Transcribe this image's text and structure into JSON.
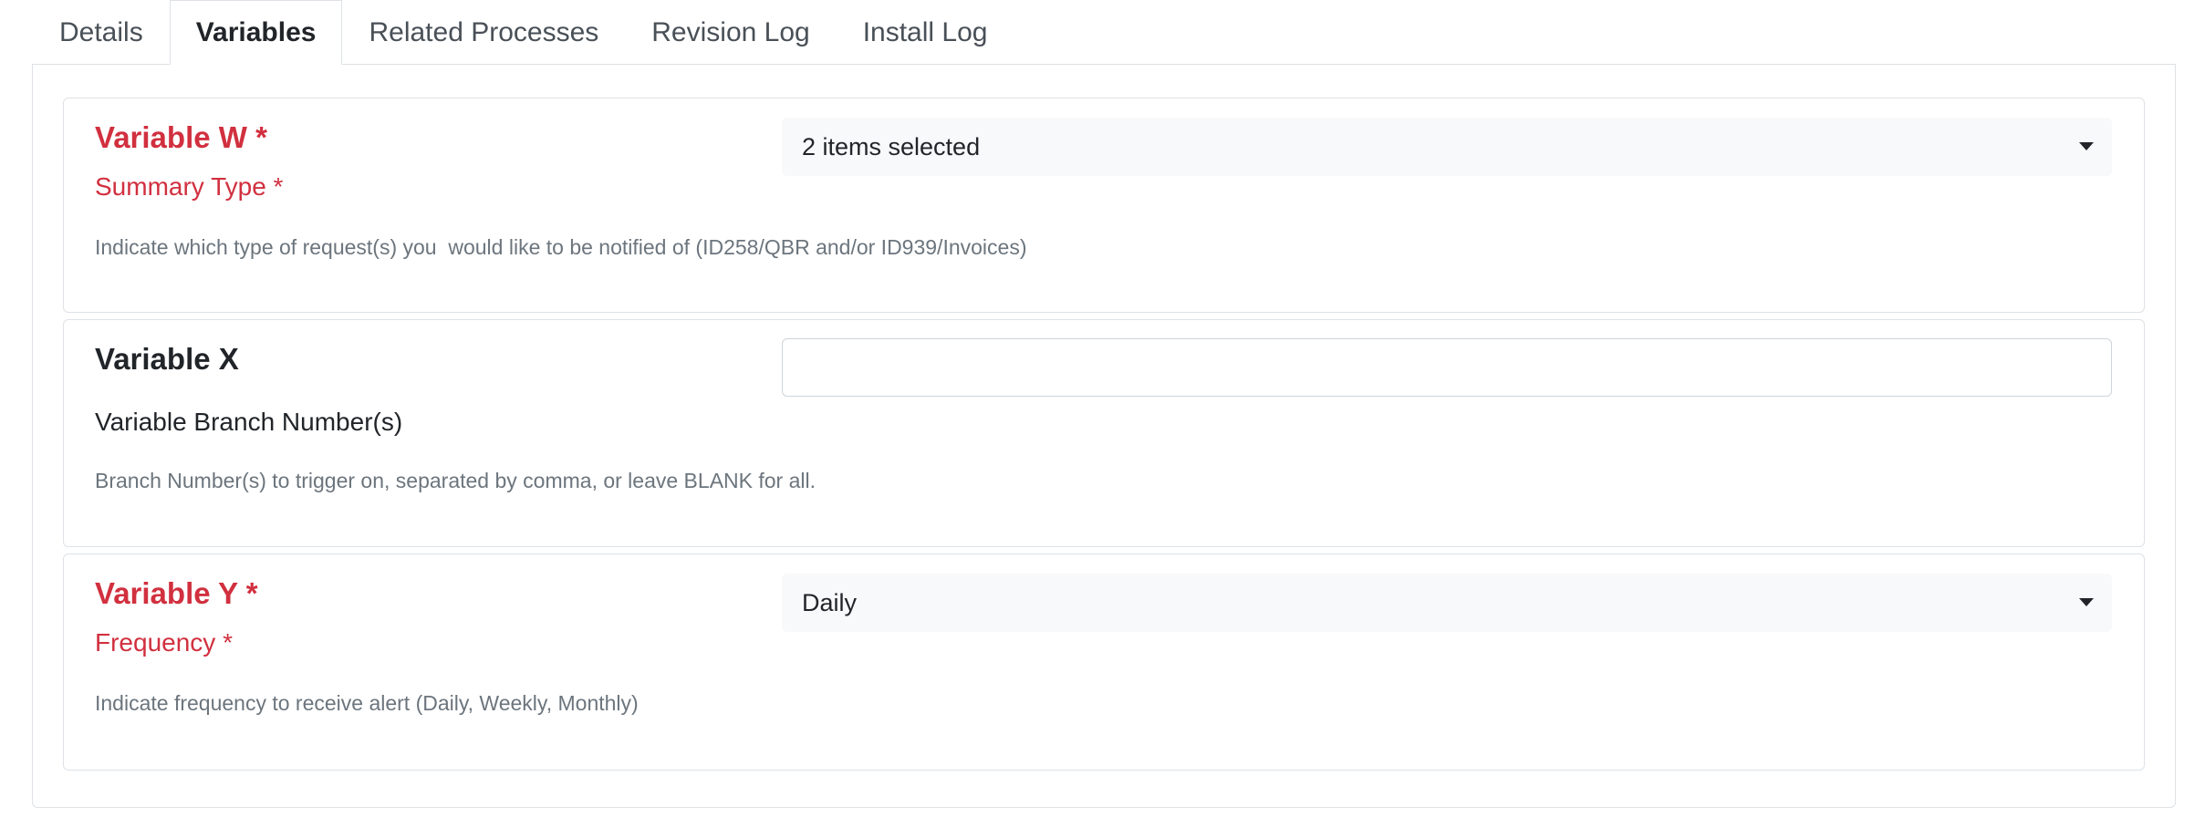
{
  "tabs": [
    {
      "label": "Details",
      "active": false
    },
    {
      "label": "Variables",
      "active": true
    },
    {
      "label": "Related Processes",
      "active": false
    },
    {
      "label": "Revision Log",
      "active": false
    },
    {
      "label": "Install Log",
      "active": false
    }
  ],
  "variables": [
    {
      "title": "Variable W *",
      "subtitle": "Summary Type *",
      "required": true,
      "help": "Indicate which type of request(s) you  would like to be notified of (ID258/QBR and/or ID939/Invoices)",
      "control": "select",
      "value": "2 items selected"
    },
    {
      "title": "Variable X",
      "subtitle": "Variable Branch Number(s)",
      "required": false,
      "help": "Branch Number(s) to trigger on, separated by comma, or leave BLANK for all.",
      "control": "text",
      "value": ""
    },
    {
      "title": "Variable Y *",
      "subtitle": "Frequency *",
      "required": true,
      "help": "Indicate frequency to receive alert (Daily, Weekly, Monthly)",
      "control": "select",
      "value": "Daily"
    }
  ],
  "colors": {
    "required": "#d1303f",
    "help_text": "#6c757d",
    "border": "#dee2e6",
    "select_bg": "#f8f9fa"
  },
  "icons": {
    "select_caret": "caret-down-icon"
  }
}
